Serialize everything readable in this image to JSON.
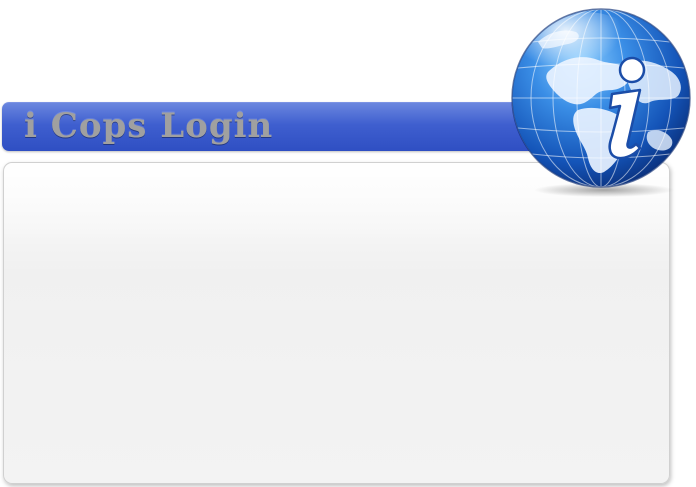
{
  "header": {
    "title": "i Cops Login"
  },
  "logo": {
    "icon": "info-globe-icon",
    "glyph": "i"
  },
  "colors": {
    "header_top": "#6a86df",
    "header_bottom": "#2f4fc3",
    "title_text": "#a0a0a0",
    "panel_bg": "#f3f3f3",
    "globe_ocean": "#1f5fc4",
    "globe_land": "#e8f2ff"
  }
}
